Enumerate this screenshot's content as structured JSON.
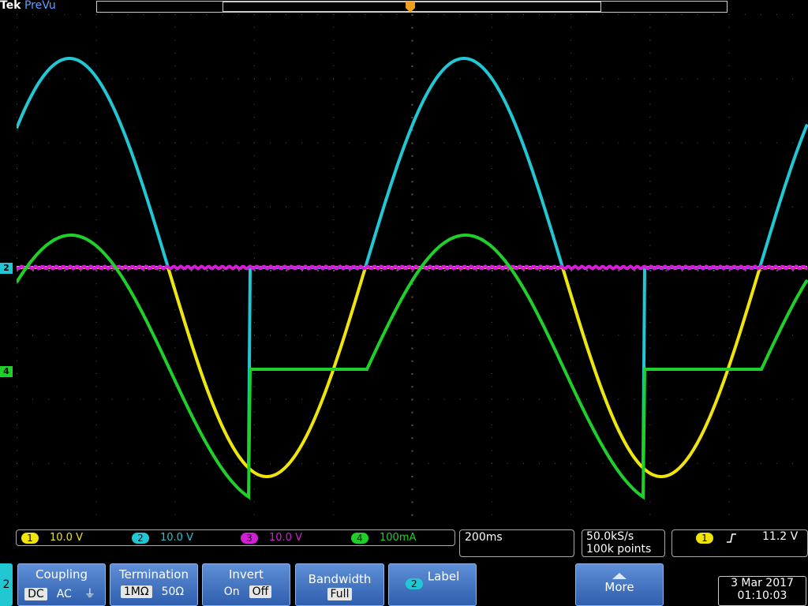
{
  "brand": {
    "tek": "Tek",
    "mode": "PreVu"
  },
  "colors": {
    "ch1": "#f1e40b",
    "ch2": "#22c7d4",
    "ch3": "#d21fd6",
    "ch4": "#1fd02b",
    "menu": "#3f6fc0"
  },
  "channels": [
    {
      "num": "1",
      "scale": "10.0 V"
    },
    {
      "num": "2",
      "scale": "10.0 V"
    },
    {
      "num": "3",
      "scale": "10.0 V"
    },
    {
      "num": "4",
      "scale": "100mA"
    }
  ],
  "markers": {
    "ch2": "2",
    "ch4": "4"
  },
  "timebase": {
    "value": "200ms"
  },
  "acquisition": {
    "rate": "50.0kS/s",
    "points": "100k points"
  },
  "trigger": {
    "channel": "1",
    "slope_icon": "rising-edge-icon",
    "level": "11.2 V"
  },
  "menu": {
    "channel_tab": "2",
    "coupling": {
      "title": "Coupling",
      "options": [
        "DC",
        "AC",
        "⏚"
      ],
      "selected": "DC"
    },
    "termination": {
      "title": "Termination",
      "options": [
        "1MΩ",
        "50Ω"
      ],
      "selected": "1MΩ"
    },
    "invert": {
      "title": "Invert",
      "options": [
        "On",
        "Off"
      ],
      "selected": "Off"
    },
    "bandwidth": {
      "title": "Bandwidth",
      "value": "Full"
    },
    "label": {
      "channel": "2",
      "text": "Label"
    },
    "more": {
      "text": "More"
    }
  },
  "datetime": {
    "date": "3 Mar 2017",
    "time": "01:10:03"
  }
}
